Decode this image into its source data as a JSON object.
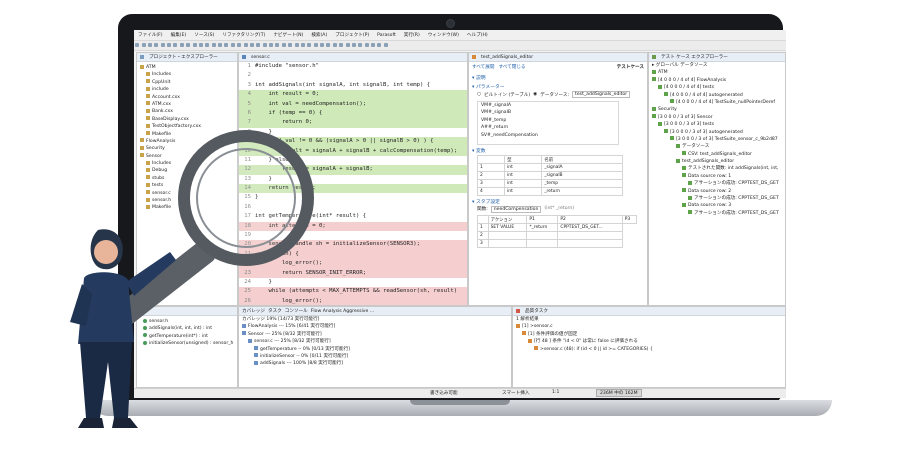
{
  "menu": [
    "ファイル(F)",
    "編集(E)",
    "ソース(S)",
    "リファクタリング(T)",
    "ナビゲート(N)",
    "検索(A)",
    "プロジェクト(P)",
    "Parasoft",
    "実行(R)",
    "ウィンドウ(W)",
    "ヘルプ(H)"
  ],
  "project_explorer": {
    "title": "プロジェクト・エクスプローラー",
    "items": [
      {
        "label": "ATM",
        "indent": 0
      },
      {
        "label": "Includes",
        "indent": 1
      },
      {
        "label": "CppUnit",
        "indent": 1
      },
      {
        "label": "include",
        "indent": 1
      },
      {
        "label": "Account.cxx",
        "indent": 1
      },
      {
        "label": "ATM.cxx",
        "indent": 1
      },
      {
        "label": "Bank.cxx",
        "indent": 1
      },
      {
        "label": "BaseDisplay.cxx",
        "indent": 1
      },
      {
        "label": "TestObjectfactory.cxx",
        "indent": 1
      },
      {
        "label": "Makefile",
        "indent": 1
      },
      {
        "label": "FlowAnalysis",
        "indent": 0
      },
      {
        "label": "Security",
        "indent": 0
      },
      {
        "label": "Sensor",
        "indent": 0
      },
      {
        "label": "Includes",
        "indent": 1
      },
      {
        "label": "Debug",
        "indent": 1
      },
      {
        "label": "stubs",
        "indent": 1
      },
      {
        "label": "tests",
        "indent": 1
      },
      {
        "label": "sensor.c",
        "indent": 1
      },
      {
        "label": "sensor.h",
        "indent": 1
      },
      {
        "label": "Makefile",
        "indent": 1
      }
    ]
  },
  "outline": {
    "items": [
      "sensor.h",
      "addSignals(int, int, int) : int",
      "getTemperature(int*) : int",
      "initializeSensor(unsigned) : sensor_h"
    ]
  },
  "editor": {
    "tab": "sensor.c",
    "lines": [
      {
        "n": "1",
        "text": "#include \"sensor.h\"",
        "cov": "white"
      },
      {
        "n": "2",
        "text": "",
        "cov": "white"
      },
      {
        "n": "3",
        "text": "int addSignals(int signalA, int signalB, int temp) {",
        "cov": "white"
      },
      {
        "n": "4",
        "text": "    int result = 0;",
        "cov": "green"
      },
      {
        "n": "5",
        "text": "    int val = needCompensation();",
        "cov": "green"
      },
      {
        "n": "6",
        "text": "    if (temp == 0) {",
        "cov": "green"
      },
      {
        "n": "7",
        "text": "        return 0;",
        "cov": "green"
      },
      {
        "n": "8",
        "text": "    }",
        "cov": "white"
      },
      {
        "n": "9",
        "text": "    if ( val != 0 && (signalA > 0 || signalB > 0) ) {",
        "cov": "green"
      },
      {
        "n": "10",
        "text": "        result = signalA + signalB + calcCompensation(temp);",
        "cov": "green"
      },
      {
        "n": "11",
        "text": "    } else {",
        "cov": "white"
      },
      {
        "n": "12",
        "text": "        result = signalA + signalB;",
        "cov": "green"
      },
      {
        "n": "13",
        "text": "    }",
        "cov": "white"
      },
      {
        "n": "14",
        "text": "    return result;",
        "cov": "green"
      },
      {
        "n": "15",
        "text": "}",
        "cov": "white"
      },
      {
        "n": "16",
        "text": "",
        "cov": "white"
      },
      {
        "n": "17",
        "text": "int getTemperature(int* result) {",
        "cov": "white"
      },
      {
        "n": "18",
        "text": "    int attempts = 0;",
        "cov": "red"
      },
      {
        "n": "19",
        "text": "",
        "cov": "white"
      },
      {
        "n": "20",
        "text": "    sensor_handle sh = initializeSensor(SENSOR3);",
        "cov": "red"
      },
      {
        "n": "21",
        "text": "    if(!sh) {",
        "cov": "red"
      },
      {
        "n": "22",
        "text": "        log_error();",
        "cov": "red"
      },
      {
        "n": "23",
        "text": "        return SENSOR_INIT_ERROR;",
        "cov": "red"
      },
      {
        "n": "24",
        "text": "    }",
        "cov": "white"
      },
      {
        "n": "25",
        "text": "    while (attempts < MAX_ATTEMPTS && readSensor(sh, result)",
        "cov": "red"
      },
      {
        "n": "26",
        "text": "        log_error();",
        "cov": "red"
      },
      {
        "n": "27",
        "text": "        ++attempts;",
        "cov": "red"
      },
      {
        "n": "28",
        "text": "    }",
        "cov": "white"
      },
      {
        "n": "29",
        "text": "    if (attempts == MAX_ATTEMPTS) {",
        "cov": "red"
      },
      {
        "n": "30",
        "text": "        finalizeSensor(sh);   // NG:test_case_getTemperature",
        "cov": "red"
      },
      {
        "n": "31",
        "text": "        finalizeSensor(0);    // OK:test_case_getTemperature",
        "cov": "red"
      },
      {
        "n": "32",
        "text": "        return SENSOR_READ_FAILED;",
        "cov": "red"
      }
    ]
  },
  "test_editor": {
    "tab": "test_addSignals_editor",
    "links": [
      "すべて展開",
      "すべて閉じる"
    ],
    "title": "テストケース",
    "sec_desc": "説明",
    "sec_params": "パラメーター",
    "param_mode_builtin": "ビルトイン (テーブル)",
    "param_mode_ds": "データソース:",
    "param_ds_value": "test_addSignals_editor",
    "params": [
      "VM#_signalA",
      "VM#_signalB",
      "VM#_temp",
      "A##_return",
      "SV#_needCompensation"
    ],
    "sec_vars": "変数",
    "vars_cols": [
      "型",
      "名前"
    ],
    "vars_rows": [
      [
        "1",
        "int",
        "_signalA"
      ],
      [
        "2",
        "int",
        "_signalB"
      ],
      [
        "3",
        "int",
        "_temp"
      ],
      [
        "4",
        "int",
        "_return"
      ]
    ],
    "sec_stub": "スタブ設定",
    "stub_label": "関数:",
    "stub_func": "needCompensation",
    "stub_ret": "(int* _return)",
    "stub_cols": [
      "アクション",
      "P1",
      "P2",
      "P3"
    ],
    "stub_rows": [
      [
        "1",
        "SET VALUE",
        "*_return",
        "CPPTEST_DS_GET..."
      ],
      [
        "2",
        "",
        "",
        ""
      ],
      [
        "3",
        "",
        "",
        ""
      ]
    ]
  },
  "test_explorer": {
    "title": "テスト ケース エクスプローラー",
    "global": "グローバル データソース",
    "items": [
      {
        "label": "ATM",
        "indent": 0
      },
      {
        "label": "[4 0 0 0 / 4 of 4] FlowAnalysis",
        "indent": 0
      },
      {
        "label": "[4 0 0 0 / 4 of 4] tests",
        "indent": 1
      },
      {
        "label": "[4 0 0 0 / 4 of 4] autogenerated",
        "indent": 2
      },
      {
        "label": "[4 0 0 0 / 4 of 4] TestSuite_nullPointerDeref",
        "indent": 3
      },
      {
        "label": "Security",
        "indent": 0
      },
      {
        "label": "[3 0 0 0 / 3 of 3] Sensor",
        "indent": 0
      },
      {
        "label": "[3 0 0 0 / 3 of 3] tests",
        "indent": 1
      },
      {
        "label": "[3 0 0 0 / 3 of 3] autogenerated",
        "indent": 2
      },
      {
        "label": "[3 0 0 0 / 3 of 3] TestSuite_sensor_c_9b2d87",
        "indent": 3
      },
      {
        "label": "データソース",
        "indent": 4
      },
      {
        "label": "CSV: test_addSignals_editor",
        "indent": 5
      },
      {
        "label": "test_addSignals_editor",
        "indent": 4
      },
      {
        "label": "テストされた関数: int addSignals(int, int,",
        "indent": 5
      },
      {
        "label": "Data source row: 1",
        "indent": 5
      },
      {
        "label": "アサーションの成功: CPPTEST_DS_GET",
        "indent": 6
      },
      {
        "label": "Data source row: 2",
        "indent": 5
      },
      {
        "label": "アサーションの成功: CPPTEST_DS_GET",
        "indent": 6
      },
      {
        "label": "Data source row: 3",
        "indent": 5
      },
      {
        "label": "アサーションの成功: CPPTEST_DS_GET",
        "indent": 6
      }
    ]
  },
  "coverage": {
    "tabs": [
      "カバレッジ",
      "タスク",
      "コンソール",
      "Flow Analysis Aggressive ..."
    ],
    "summary": "カバレッジ 19% [14/73 実行可能行]",
    "items": [
      {
        "label": "FlowAnalysis --- 15% [6/41 実行可能行]",
        "indent": 0
      },
      {
        "label": "Sensor --- 25% [8/32 実行可能行]",
        "indent": 0
      },
      {
        "label": "sensor.c --- 25% [8/32 実行可能行]",
        "indent": 1
      },
      {
        "label": "getTemperature -- 0% [0/13 実行可能行]",
        "indent": 2
      },
      {
        "label": "initializeSensor -- 0% [0/11 実行可能行]",
        "indent": 2
      },
      {
        "label": "addSignals --- 100% [8/8 実行可能行]",
        "indent": 2
      }
    ]
  },
  "quality": {
    "tab": "品質タスク",
    "summary": "1 解析結果",
    "items": [
      {
        "label": "[1] >sensor.c",
        "indent": 0
      },
      {
        "label": "[1] 条件評価の値が固定",
        "indent": 1
      },
      {
        "label": "[行 48 ] 条件 \"id < 0\" は常に false に評価される",
        "indent": 2
      },
      {
        "label": ">sensor.c (48): if (id < 0 || id >= CATEGORIES) {",
        "indent": 3
      }
    ]
  },
  "status": {
    "writable": "書き込み可能",
    "insert": "スマート挿入",
    "position": "1:1",
    "memory": "236M 中の 162M"
  }
}
